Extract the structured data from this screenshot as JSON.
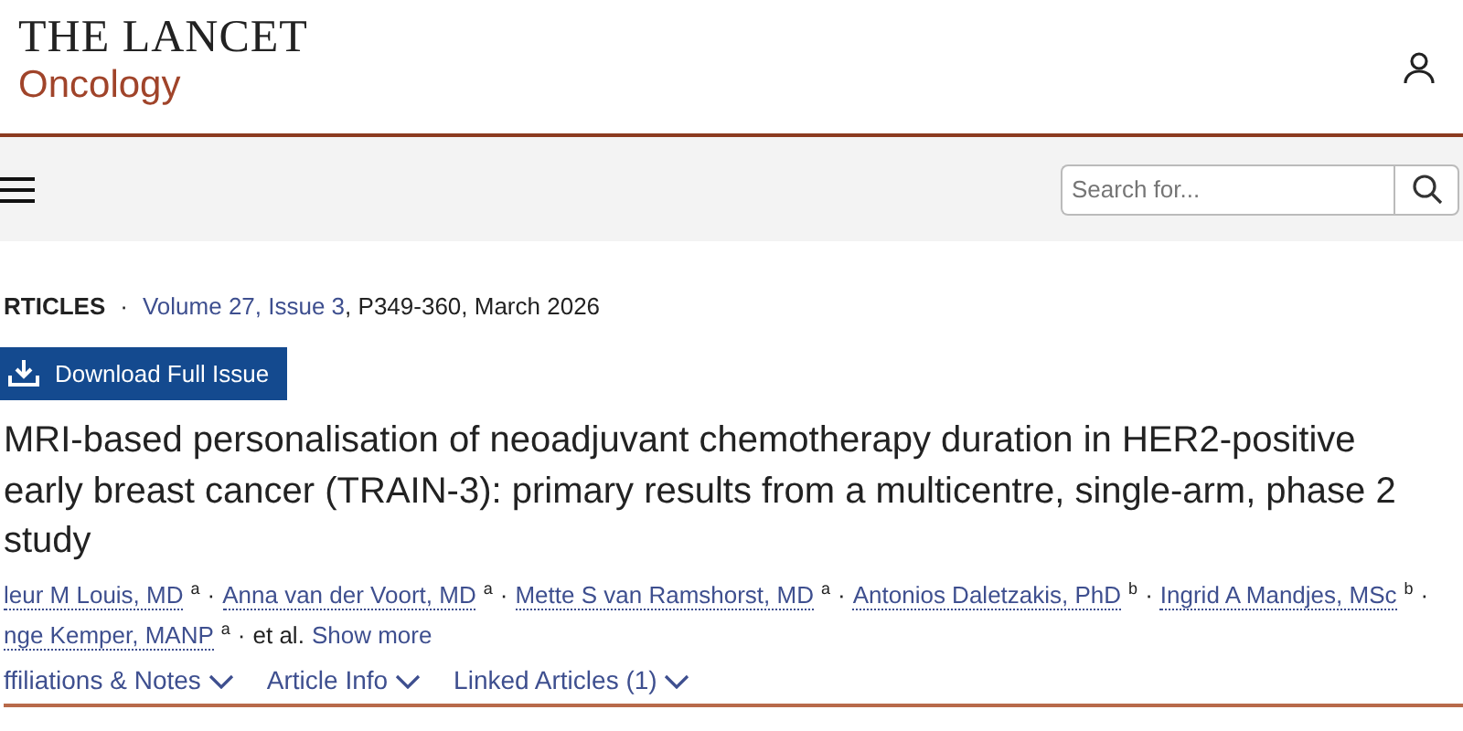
{
  "header": {
    "journal": "THE LANCET",
    "subtitle": "Oncology"
  },
  "search": {
    "placeholder": "Search for..."
  },
  "meta": {
    "section": "RTICLES",
    "separator": "·",
    "issue_link": "Volume 27, Issue 3",
    "rest": ", P349-360, March 2026"
  },
  "download_button": "Download Full Issue",
  "title_lines": [
    "MRI-based personalisation of neoadjuvant chemotherapy duration in HER2-positive",
    "early breast cancer (TRAIN-3): primary results from a multicentre, single-arm, phase 2",
    "study"
  ],
  "author_lines": [
    [
      {
        "name": "leur M Louis, MD",
        "sup": "a",
        "separator": "·"
      },
      {
        "name": "Anna van der Voort, MD",
        "sup": "a",
        "separator": "·"
      },
      {
        "name": "Mette S van Ramshorst, MD",
        "sup": "a",
        "separator": "·"
      },
      {
        "name": "Antonios Daletzakis, PhD",
        "sup": "b",
        "separator": "·"
      },
      {
        "name": "Ingrid A Mandjes, MSc",
        "sup": "b",
        "separator": "·"
      }
    ],
    [
      {
        "name": "nge Kemper, MANP",
        "sup": "a",
        "separator": "·"
      }
    ]
  ],
  "et_al": "et al.",
  "show_more": "Show more",
  "tabs": [
    {
      "label": "ffiliations & Notes"
    },
    {
      "label": "Article Info"
    },
    {
      "label": "Linked Articles (1)"
    }
  ]
}
